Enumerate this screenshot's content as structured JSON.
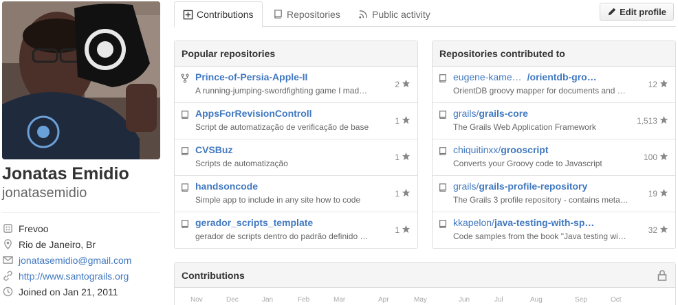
{
  "profile": {
    "full_name": "Jonatas Emidio",
    "username": "jonatasemidio",
    "details": [
      {
        "icon": "organization-icon",
        "text": "Frevoo",
        "link": false
      },
      {
        "icon": "location-icon",
        "text": "Rio de Janeiro, Br",
        "link": false
      },
      {
        "icon": "mail-icon",
        "text": "jonatasemidio@gmail.com",
        "link": true
      },
      {
        "icon": "link-icon",
        "text": "http://www.santograils.org",
        "link": true
      },
      {
        "icon": "clock-icon",
        "text": "Joined on Jan 21, 2011",
        "link": false
      }
    ]
  },
  "tabs": [
    {
      "label": "Contributions",
      "icon": "plus-square-icon",
      "selected": true
    },
    {
      "label": "Repositories",
      "icon": "repo-icon",
      "selected": false
    },
    {
      "label": "Public activity",
      "icon": "rss-icon",
      "selected": false
    }
  ],
  "edit_profile_label": "Edit profile",
  "popular": {
    "title": "Popular repositories",
    "items": [
      {
        "name": "Prince-of-Persia-Apple-II",
        "desc": "A running-jumping-swordfighting game I mad…",
        "stars": "2",
        "fork": true
      },
      {
        "name": "AppsForRevisionControll",
        "desc": "Script de automatização de verificação de base",
        "stars": "1",
        "fork": false
      },
      {
        "name": "CVSBuz",
        "desc": "Scripts de automatização",
        "stars": "1",
        "fork": false
      },
      {
        "name": "handsoncode",
        "desc": "Simple app to include in any site how to code",
        "stars": "1",
        "fork": false
      },
      {
        "name": "gerador_scripts_template",
        "desc": "gerador de scripts dentro do padrão definido …",
        "stars": "1",
        "fork": false
      }
    ]
  },
  "contributed": {
    "title": "Repositories contributed to",
    "items": [
      {
        "owner": "eugene-kame…",
        "repo": "/orientdb-gro…",
        "desc": "OrientDB groovy mapper for documents and …",
        "stars": "12"
      },
      {
        "owner": "grails/",
        "repo": "grails-core",
        "desc": "The Grails Web Application Framework",
        "stars": "1,513"
      },
      {
        "owner": "chiquitinxx/",
        "repo": "grooscript",
        "desc": "Converts your Groovy code to Javascript",
        "stars": "100"
      },
      {
        "owner": "grails/",
        "repo": "grails-profile-repository",
        "desc": "The Grails 3 profile repository - contains meta…",
        "stars": "19"
      },
      {
        "owner": "kkapelon/",
        "repo": "java-testing-with-sp…",
        "desc": "Code samples from the book \"Java testing wit…",
        "stars": "32"
      }
    ]
  },
  "contributions": {
    "title": "Contributions",
    "months": [
      "Nov",
      "Dec",
      "Jan",
      "Feb",
      "Mar",
      "Apr",
      "May",
      "Jun",
      "Jul",
      "Aug",
      "Sep",
      "Oct"
    ]
  }
}
